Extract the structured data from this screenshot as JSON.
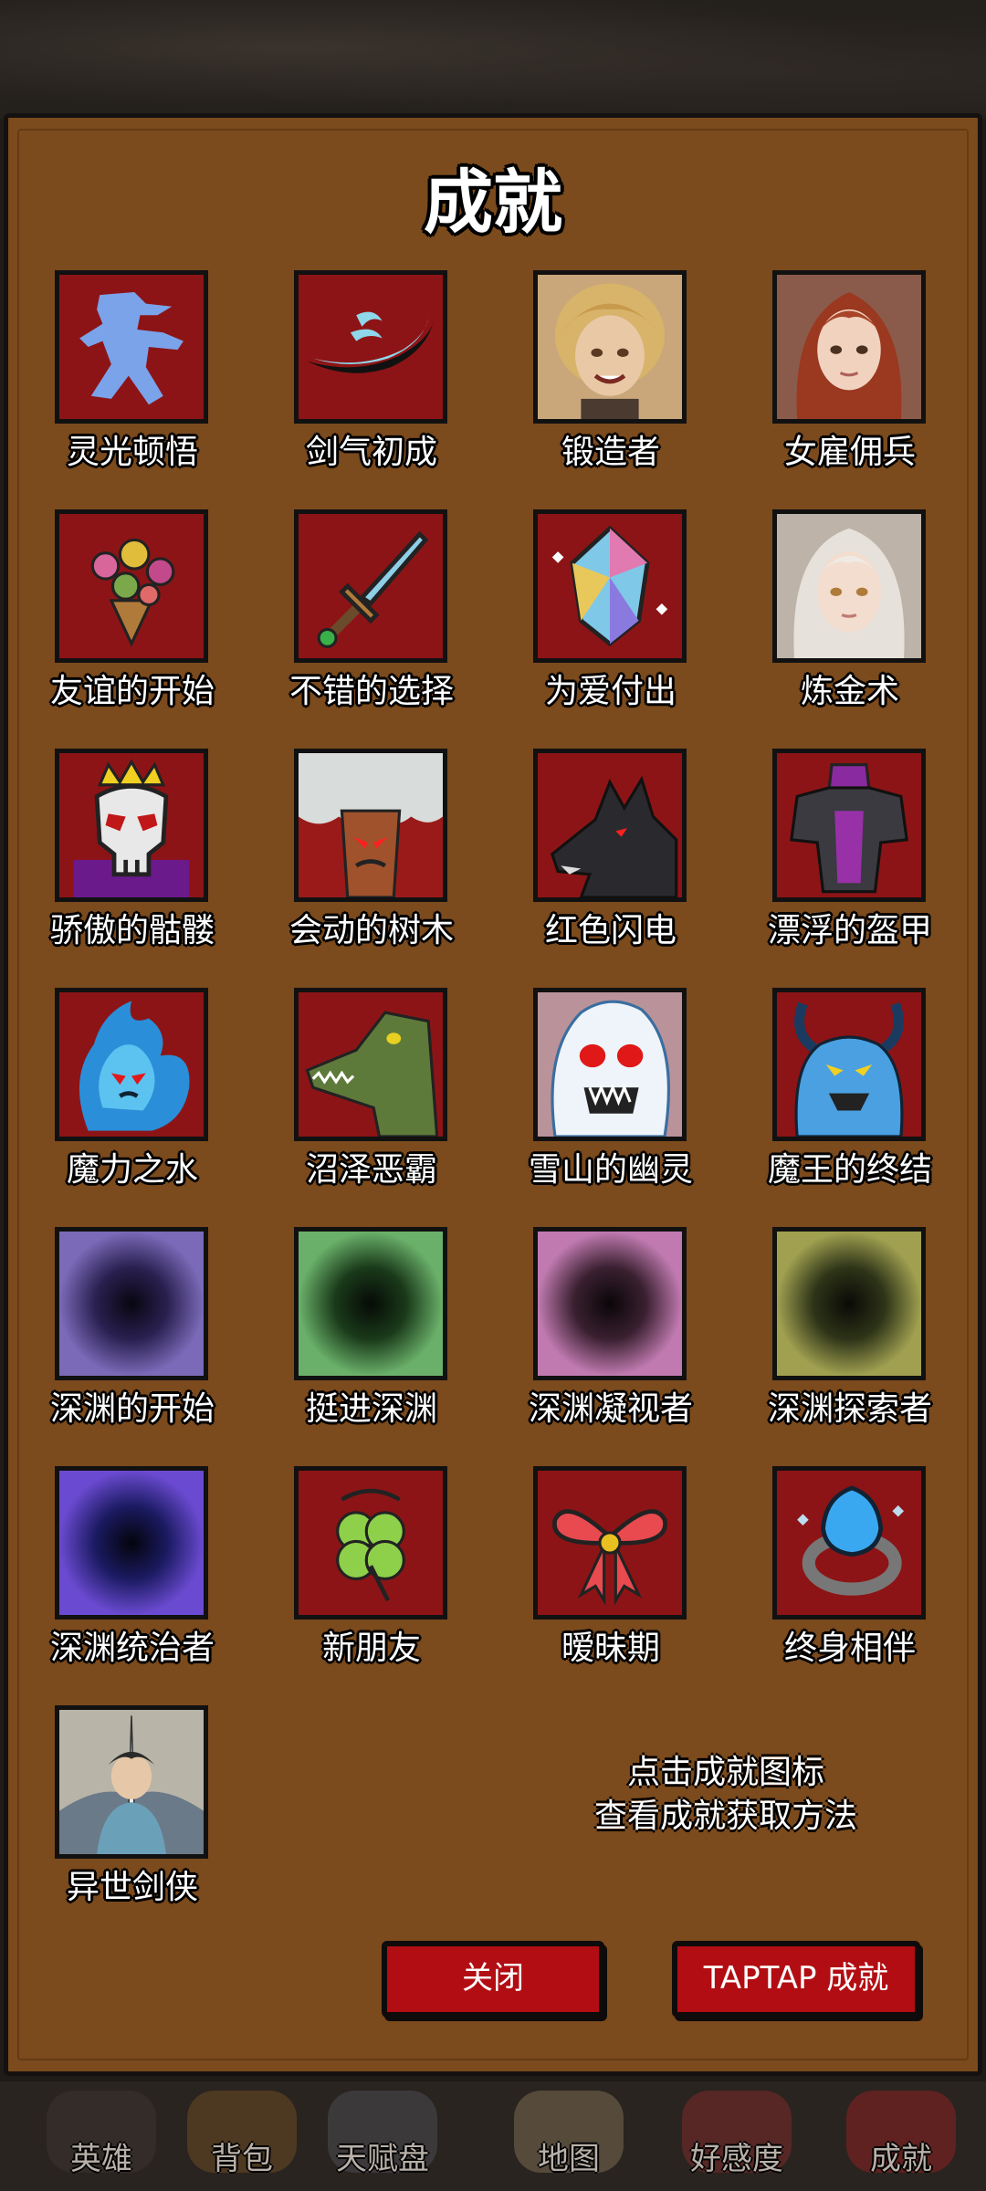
{
  "title": "成就",
  "achievements": [
    {
      "label": "灵光顿悟",
      "icon": "ninja-silhouette-icon"
    },
    {
      "label": "剑气初成",
      "icon": "sword-wave-icon"
    },
    {
      "label": "锻造者",
      "icon": "blonde-smith-portrait-icon"
    },
    {
      "label": "女雇佣兵",
      "icon": "red-hair-woman-portrait-icon"
    },
    {
      "label": "友谊的开始",
      "icon": "flower-bouquet-icon"
    },
    {
      "label": "不错的选择",
      "icon": "sword-icon"
    },
    {
      "label": "为爱付出",
      "icon": "crystal-gem-icon"
    },
    {
      "label": "炼金术",
      "icon": "white-hair-girl-portrait-icon"
    },
    {
      "label": "骄傲的骷髅",
      "icon": "crowned-skull-icon"
    },
    {
      "label": "会动的树木",
      "icon": "living-tree-icon"
    },
    {
      "label": "红色闪电",
      "icon": "black-wolf-icon"
    },
    {
      "label": "漂浮的盔甲",
      "icon": "floating-armor-icon"
    },
    {
      "label": "魔力之水",
      "icon": "water-spirit-icon"
    },
    {
      "label": "沼泽恶霸",
      "icon": "crocodile-icon"
    },
    {
      "label": "雪山的幽灵",
      "icon": "snow-ghost-icon"
    },
    {
      "label": "魔王的终结",
      "icon": "demon-king-icon"
    },
    {
      "label": "深渊的开始",
      "icon": "abyss-purple-icon"
    },
    {
      "label": "挺进深渊",
      "icon": "abyss-green-icon"
    },
    {
      "label": "深渊凝视者",
      "icon": "abyss-pink-icon"
    },
    {
      "label": "深渊探索者",
      "icon": "abyss-olive-icon"
    },
    {
      "label": "深渊统治者",
      "icon": "abyss-blue-icon"
    },
    {
      "label": "新朋友",
      "icon": "four-leaf-clover-icon"
    },
    {
      "label": "暧昧期",
      "icon": "red-bow-icon"
    },
    {
      "label": "终身相伴",
      "icon": "blue-gem-ring-icon"
    },
    {
      "label": "异世剑侠",
      "icon": "swordsman-portrait-icon"
    }
  ],
  "hint": {
    "line1": "点击成就图标",
    "line2": "查看成就获取方法"
  },
  "buttons": {
    "close": "关闭",
    "taptap": "TAPTAP 成就"
  },
  "tabs": [
    "英雄",
    "背包",
    "天赋盘",
    "地图",
    "好感度",
    "成就"
  ],
  "colors": {
    "panel": "#7b4a1d",
    "icon_bg": "#8d1416",
    "button": "#b20d12"
  }
}
